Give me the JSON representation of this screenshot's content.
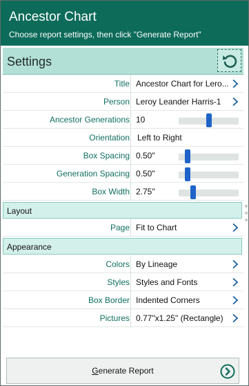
{
  "header": {
    "title": "Ancestor Chart",
    "subtitle": "Choose report settings, then click \"Generate Report\""
  },
  "settings_bar": {
    "label": "Settings"
  },
  "rows": {
    "title": {
      "label": "Title",
      "value": "Ancestor Chart for Lero..."
    },
    "person": {
      "label": "Person",
      "value": "Leroy Leander Harris-1"
    },
    "generations": {
      "label": "Ancestor Generations",
      "value": "10",
      "slider_fraction": 0.5
    },
    "orientation": {
      "label": "Orientation",
      "value": "Left to Right"
    },
    "box_spacing": {
      "label": "Box Spacing",
      "value": "0.50\"",
      "slider_fraction": 0.12
    },
    "generation_spacing": {
      "label": "Generation Spacing",
      "value": "0.50\"",
      "slider_fraction": 0.12
    },
    "box_width": {
      "label": "Box Width",
      "value": "2.75\"",
      "slider_fraction": 0.22
    },
    "page": {
      "label": "Page",
      "value": "Fit to Chart"
    },
    "colors": {
      "label": "Colors",
      "value": "By Lineage"
    },
    "styles": {
      "label": "Styles",
      "value": "Styles and Fonts"
    },
    "box_border": {
      "label": "Box Border",
      "value": "Indented Corners"
    },
    "pictures": {
      "label": "Pictures",
      "value": "0.77\"x1.25\" (Rectangle)"
    }
  },
  "sections": {
    "layout": "Layout",
    "appearance": "Appearance"
  },
  "footer": {
    "button_first_letter": "G",
    "button_rest": "enerate Report"
  },
  "colors": {
    "header_bg": "#0d6b5a",
    "label_text": "#0f6f60",
    "slider_thumb": "#1f63c8",
    "section_bg": "#d3f0ea"
  },
  "icons": {
    "reset": "reset-icon",
    "chevron": "chevron-right-icon",
    "go": "arrow-circle-right-icon"
  }
}
